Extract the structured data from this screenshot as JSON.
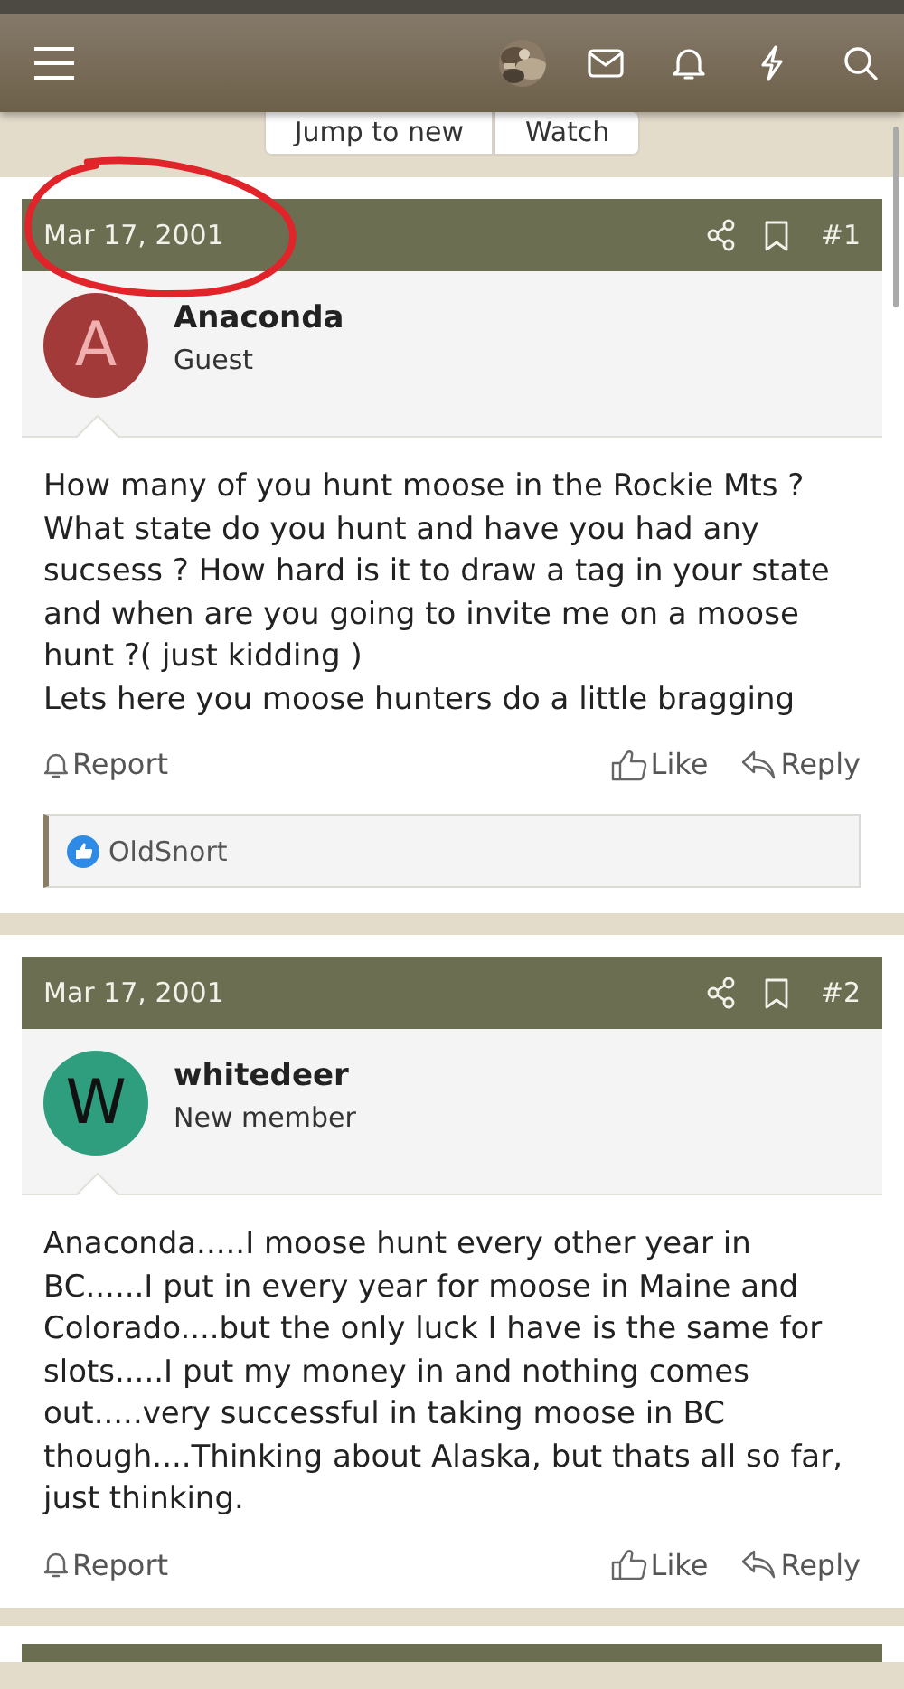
{
  "header": {
    "has_user_avatar": true
  },
  "thread_buttons": [
    "Jump to new",
    "Watch"
  ],
  "posts": [
    {
      "date": "Mar 17, 2001",
      "number": "#1",
      "author": "Anaconda",
      "role": "Guest",
      "avatar_letter": "A",
      "color": "#a33a3a",
      "annotated": true,
      "body": [
        "How many of you hunt moose in the Rockie Mts ? What state do you hunt and have you had any sucsess ? How hard is it to draw a tag in your state and when are you going to invite me on a moose hunt ?( just kidding )",
        "Lets here you moose hunters do a little bragging"
      ],
      "actions": {
        "report": "Report",
        "like": "Like",
        "reply": "Reply"
      },
      "reactions": [
        "OldSnort"
      ]
    },
    {
      "date": "Mar 17, 2001",
      "number": "#2",
      "author": "whitedeer",
      "role": "New member",
      "avatar_letter": "W",
      "color": "#2e9e7f",
      "annotated": false,
      "body": [
        "Anaconda.....I moose hunt every other year in BC......I put in every year for moose in Maine and Colorado....but the only luck I have is the same for slots.....I put my money in and nothing comes out.....very successful in taking moose in BC though....Thinking about Alaska, but thats all so far, just thinking."
      ],
      "actions": {
        "report": "Report",
        "like": "Like",
        "reply": "Reply"
      }
    }
  ]
}
